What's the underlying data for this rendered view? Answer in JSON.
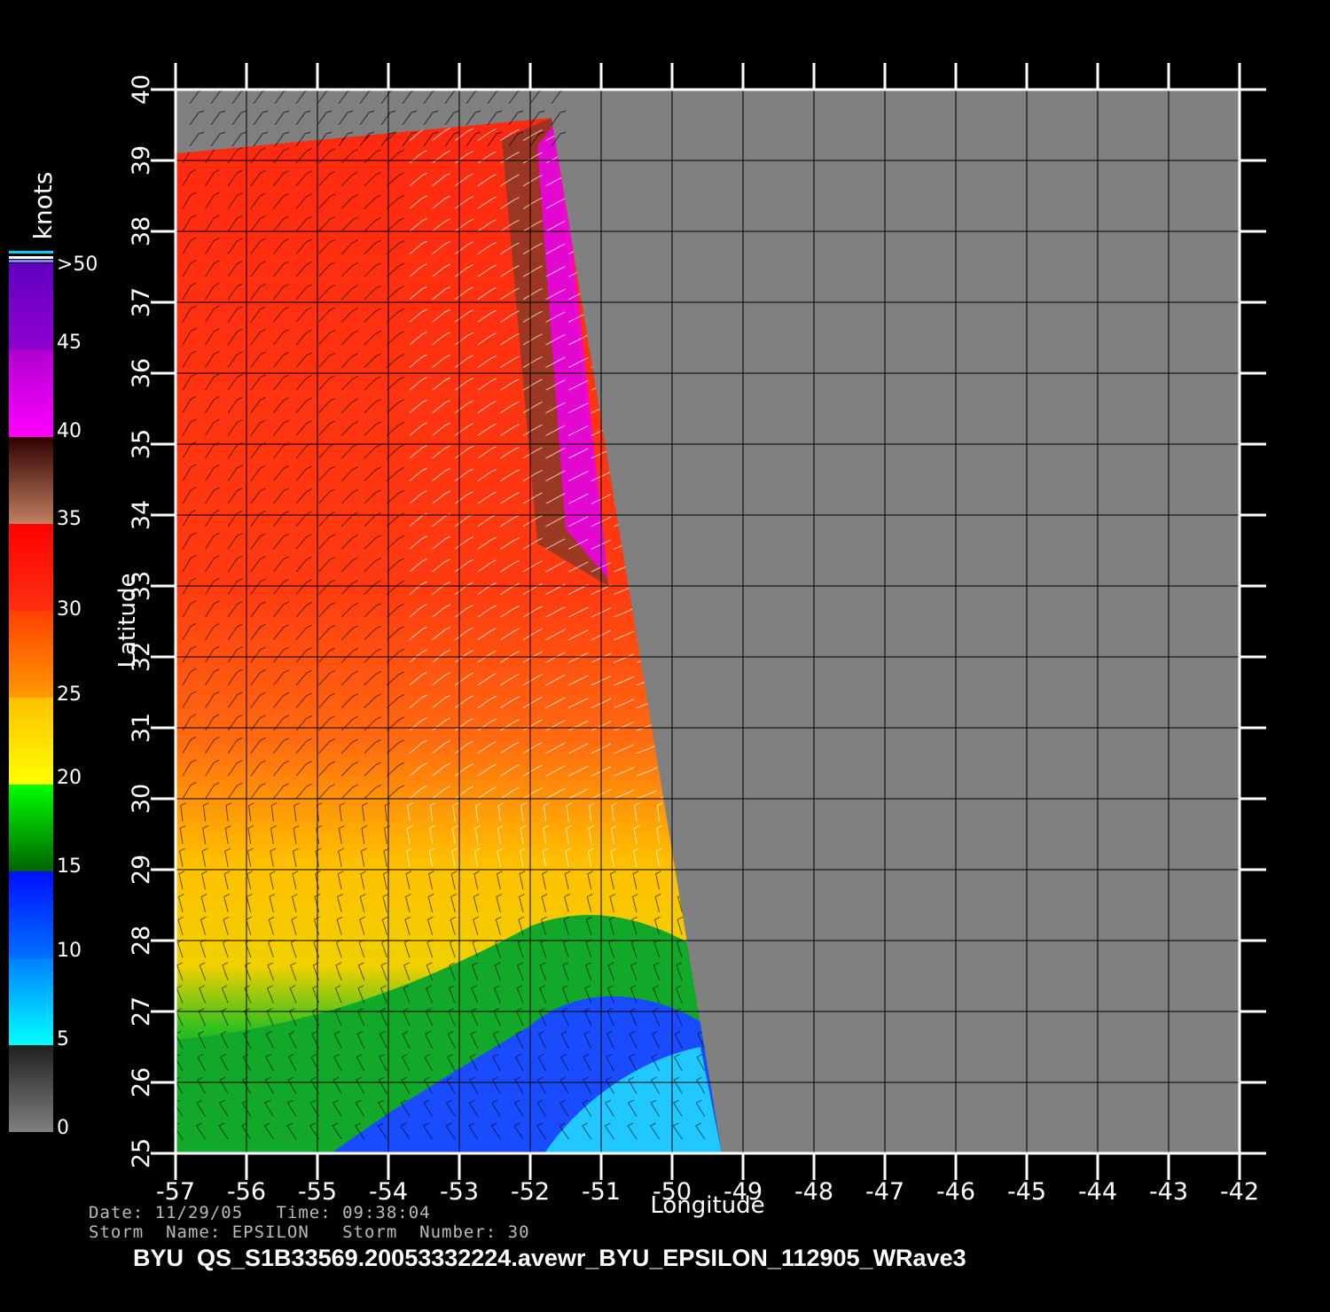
{
  "map": {
    "lon_range": [
      -57,
      -42
    ],
    "lat_range": [
      25,
      40
    ],
    "lon_ticks": [
      "-57",
      "-56",
      "-55",
      "-54",
      "-53",
      "-52",
      "-51",
      "-50",
      "-49",
      "-48",
      "-47",
      "-46",
      "-45",
      "-44",
      "-43",
      "-42"
    ],
    "lat_ticks": [
      "25",
      "26",
      "27",
      "28",
      "29",
      "30",
      "31",
      "32",
      "33",
      "34",
      "35",
      "36",
      "37",
      "38",
      "39",
      "40"
    ],
    "x_axis_label": "Longitude",
    "y_axis_label": "Latitude",
    "land_or_nodata_color": "#808080",
    "grid_color": "#000000",
    "swath_polygon_lonlat": [
      [
        -57,
        39.1
      ],
      [
        -51.7,
        39.6
      ],
      [
        -49.3,
        25
      ],
      [
        -57,
        25
      ]
    ],
    "wind_field_description_zones": [
      {
        "region": "north",
        "speed_knots": "30-35",
        "color": "#ff2a10"
      },
      {
        "region": "swath edge",
        "speed_knots": "35-45",
        "color": "#ee00ee"
      },
      {
        "region": "middle",
        "speed_knots": "20-30",
        "color": "#ffaa00"
      },
      {
        "region": "south band",
        "speed_knots": "15-20",
        "color": "#00cc22"
      },
      {
        "region": "southeast",
        "speed_knots": "5-15",
        "color": "#0055ff"
      }
    ]
  },
  "colorbar": {
    "title": "knots",
    "labels": [
      ">50",
      "45",
      "40",
      "35",
      "30",
      "25",
      "20",
      "15",
      "10",
      "5",
      "0"
    ],
    "segments": [
      {
        "from": 0,
        "to": 5,
        "colors": [
          "#808080",
          "#202020"
        ]
      },
      {
        "from": 5,
        "to": 10,
        "colors": [
          "#00ffff",
          "#0080ff"
        ]
      },
      {
        "from": 10,
        "to": 15,
        "colors": [
          "#0070ff",
          "#0010ff"
        ]
      },
      {
        "from": 15,
        "to": 20,
        "colors": [
          "#006400",
          "#00ff00"
        ]
      },
      {
        "from": 20,
        "to": 25,
        "colors": [
          "#ffff00",
          "#ffc000"
        ]
      },
      {
        "from": 25,
        "to": 30,
        "colors": [
          "#ff9a00",
          "#ff4000"
        ]
      },
      {
        "from": 30,
        "to": 35,
        "colors": [
          "#ff3010",
          "#ff0000"
        ]
      },
      {
        "from": 35,
        "to": 40,
        "colors": [
          "#c08060",
          "#300000"
        ]
      },
      {
        "from": 40,
        "to": 45,
        "colors": [
          "#ff00ff",
          "#b000d0"
        ]
      },
      {
        "from": 45,
        "to": 50,
        "colors": [
          "#9000d0",
          "#6000c0"
        ]
      }
    ]
  },
  "footer": {
    "date_line": "Date: 11/29/05   Time: 09:38:04",
    "storm_line": "Storm  Name: EPSILON   Storm  Number: 30",
    "product": "BYU  QS_S1B33569.20053332224.avewr_BYU_EPSILON_112905_WRave3"
  }
}
